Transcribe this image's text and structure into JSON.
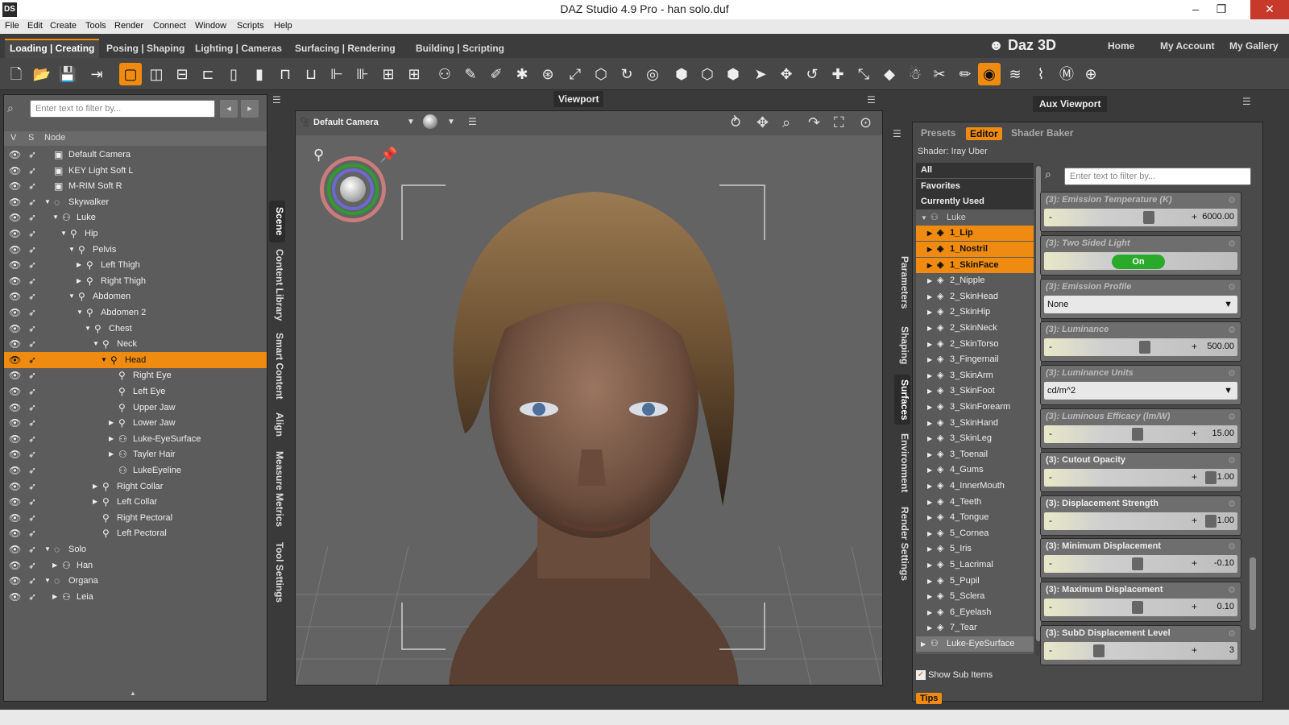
{
  "window": {
    "title": "DAZ Studio 4.9 Pro - han solo.duf",
    "app_icon": "DS"
  },
  "menu": [
    "File",
    "Edit",
    "Create",
    "Tools",
    "Render",
    "Connect",
    "Window",
    "Scripts",
    "Help"
  ],
  "tabs": [
    "Loading | Creating",
    "Posing | Shaping",
    "Lighting | Cameras",
    "Surfacing | Rendering",
    "Building | Scripting"
  ],
  "brand": {
    "logo": "Daz 3D",
    "links": [
      "Home",
      "My Account",
      "My Gallery"
    ]
  },
  "scene": {
    "filter_placeholder": "Enter text to filter by...",
    "cols": [
      "V",
      "S",
      "Node"
    ],
    "nodes": [
      {
        "label": "Default Camera"
      },
      {
        "label": "KEY Light Soft L"
      },
      {
        "label": "M-RIM Soft R"
      },
      {
        "label": "Skywalker"
      },
      {
        "label": "Luke"
      },
      {
        "label": "Hip"
      },
      {
        "label": "Pelvis"
      },
      {
        "label": "Left Thigh"
      },
      {
        "label": "Right Thigh"
      },
      {
        "label": "Abdomen"
      },
      {
        "label": "Abdomen 2"
      },
      {
        "label": "Chest"
      },
      {
        "label": "Neck"
      },
      {
        "label": "Head"
      },
      {
        "label": "Right Eye"
      },
      {
        "label": "Left Eye"
      },
      {
        "label": "Upper Jaw"
      },
      {
        "label": "Lower Jaw"
      },
      {
        "label": "Luke-EyeSurface"
      },
      {
        "label": "Tayler Hair"
      },
      {
        "label": "LukeEyeline"
      },
      {
        "label": "Right Collar"
      },
      {
        "label": "Left Collar"
      },
      {
        "label": "Right Pectoral"
      },
      {
        "label": "Left Pectoral"
      },
      {
        "label": "Solo"
      },
      {
        "label": "Han"
      },
      {
        "label": "Organa"
      },
      {
        "label": "Leia"
      }
    ],
    "side_tabs": [
      "Scene",
      "Content Library",
      "Smart Content",
      "Align",
      "Measure Metrics",
      "Tool Settings"
    ]
  },
  "viewport": {
    "title": "Viewport",
    "camera": "Default Camera"
  },
  "aux": {
    "title": "Aux Viewport",
    "side_tabs": [
      "Parameters",
      "Shaping",
      "Surfaces",
      "Environment",
      "Render Settings"
    ],
    "surface_tabs": [
      "Presets",
      "Editor",
      "Shader Baker"
    ],
    "shader": "Shader: Iray Uber",
    "filter_placeholder": "Enter text to filter by...",
    "categories": [
      "All",
      "Favorites",
      "Currently Used"
    ],
    "figure": "Luke",
    "materials": [
      "1_Lip",
      "1_Nostril",
      "1_SkinFace",
      "2_Nipple",
      "2_SkinHead",
      "2_SkinHip",
      "2_SkinNeck",
      "2_SkinTorso",
      "3_Fingernail",
      "3_SkinArm",
      "3_SkinFoot",
      "3_SkinForearm",
      "3_SkinHand",
      "3_SkinLeg",
      "3_Toenail",
      "4_Gums",
      "4_InnerMouth",
      "4_Teeth",
      "4_Tongue",
      "5_Cornea",
      "5_Iris",
      "5_Lacrimal",
      "5_Pupil",
      "5_Sclera",
      "6_Eyelash",
      "7_Tear"
    ],
    "eye_surface": "Luke-EyeSurface",
    "show_sub_items": "Show Sub Items",
    "tips": "Tips",
    "props": [
      {
        "label": "(3): Emission Temperature (K)",
        "value": "6000.00",
        "kind": "slider",
        "enabled": false
      },
      {
        "label": "(3): Two Sided Light",
        "value": "On",
        "kind": "toggle",
        "enabled": false
      },
      {
        "label": "(3): Emission Profile",
        "value": "None",
        "kind": "dropdown",
        "enabled": false
      },
      {
        "label": "(3): Luminance",
        "value": "500.00",
        "kind": "slider",
        "enabled": false
      },
      {
        "label": "(3): Luminance Units",
        "value": "cd/m^2",
        "kind": "dropdown",
        "enabled": false
      },
      {
        "label": "(3): Luminous Efficacy (lm/W)",
        "value": "15.00",
        "kind": "slider",
        "enabled": false
      },
      {
        "label": "(3): Cutout Opacity",
        "value": "1.00",
        "kind": "slider",
        "enabled": true
      },
      {
        "label": "(3): Displacement Strength",
        "value": "1.00",
        "kind": "slider",
        "enabled": true
      },
      {
        "label": "(3): Minimum Displacement",
        "value": "-0.10",
        "kind": "slider",
        "enabled": true
      },
      {
        "label": "(3): Maximum Displacement",
        "value": "0.10",
        "kind": "slider",
        "enabled": true
      },
      {
        "label": "(3): SubD Displacement Level",
        "value": "3",
        "kind": "slider",
        "enabled": true
      }
    ]
  }
}
